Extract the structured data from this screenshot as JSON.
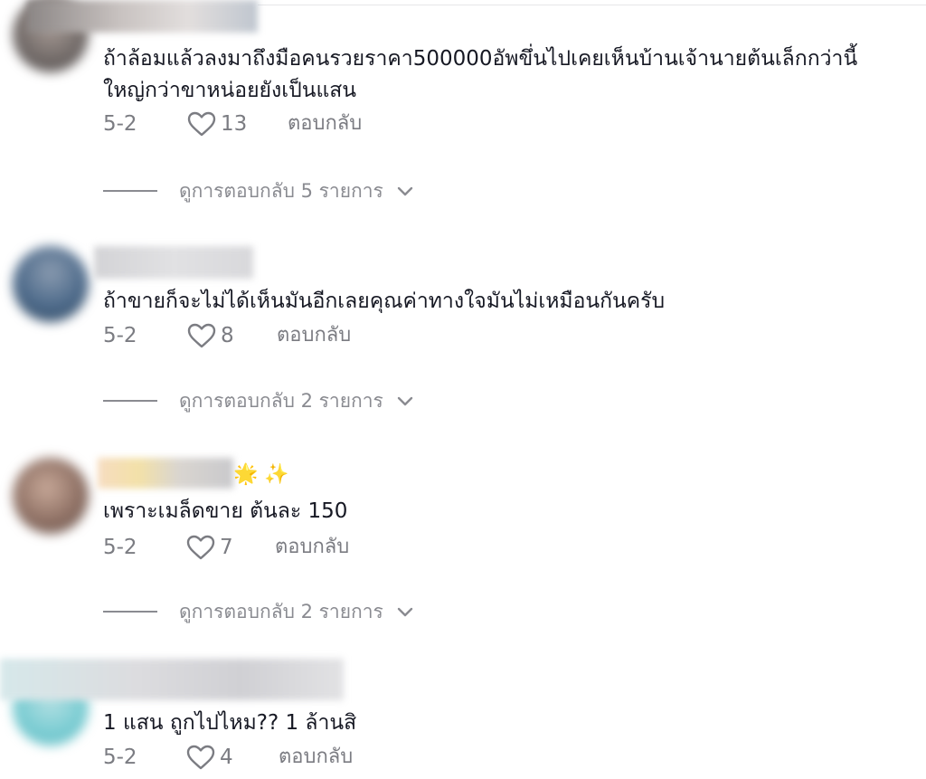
{
  "comments": [
    {
      "text_line1": "ถ้าล้อมแล้วลงมาถึงมือคนรวยราคา500000อัพขึ่นไปเคยเห็นบ้านเจ้านายต้นเล็กกว่านี้",
      "text_line2": "ใหญ่กว่าขาหน่อยยังเป็นแสน",
      "date": "5-2",
      "likes": "13",
      "reply_label": "ตอบกลับ",
      "view_replies_label": "ดูการตอบกลับ 5 รายการ"
    },
    {
      "text_line1": "ถ้าขายก็จะไม่ได้เห็นมันอีกเลยคุณค่าทางใจมันไม่เหมือนกันครับ",
      "date": "5-2",
      "likes": "8",
      "reply_label": "ตอบกลับ",
      "view_replies_label": "ดูการตอบกลับ 2 รายการ"
    },
    {
      "text_line1": "เพราะเมล็ดขาย ต้นละ 150",
      "date": "5-2",
      "likes": "7",
      "reply_label": "ตอบกลับ",
      "view_replies_label": "ดูการตอบกลับ 2 รายการ",
      "name_emojis": "🌟 ✨"
    },
    {
      "text_line1": "1 แสน ถูกไปไหม?? 1 ล้านสิ",
      "date": "5-2",
      "likes": "4",
      "reply_label": "ตอบกลับ"
    }
  ],
  "icons": {
    "like": "heart-outline-icon",
    "expand": "chevron-down-icon"
  },
  "colors": {
    "text": "#161823",
    "meta": "#7b7c82",
    "divider": "#e6e6e8"
  }
}
